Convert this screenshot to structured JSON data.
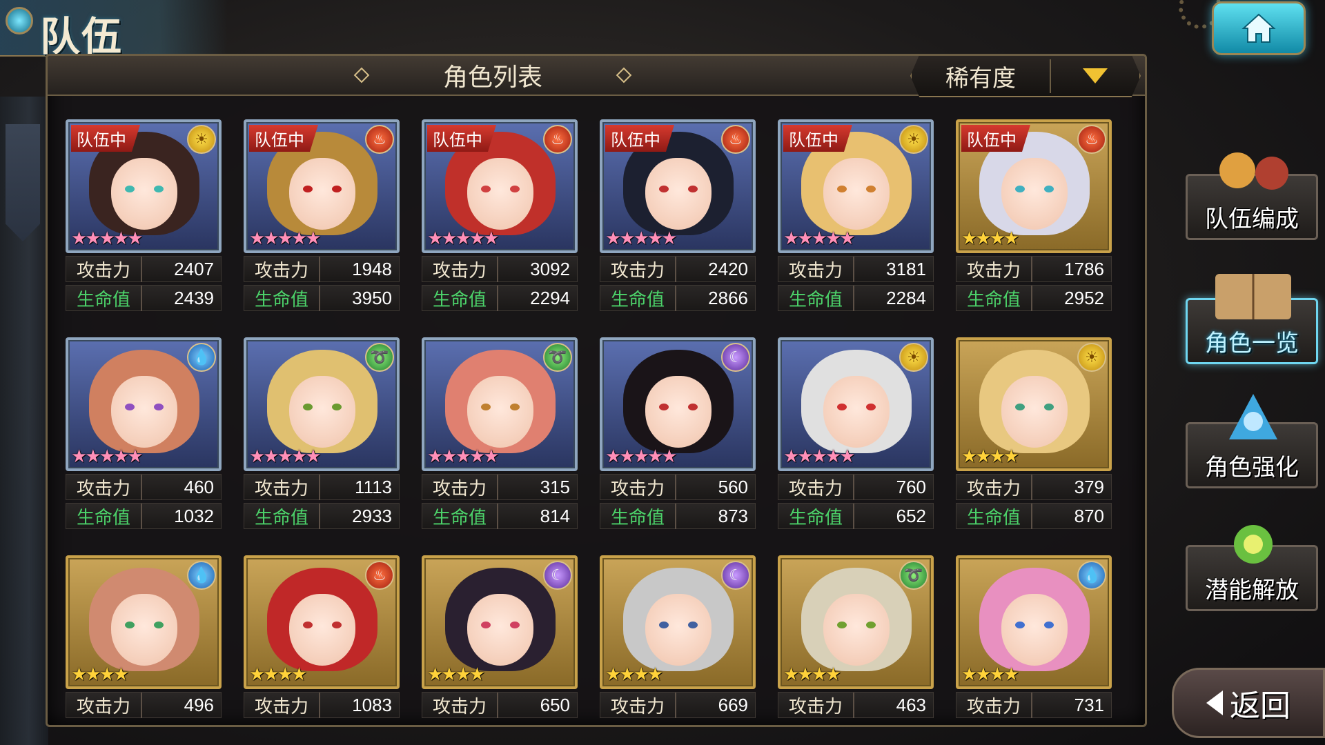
{
  "header": {
    "title": "队伍"
  },
  "panel": {
    "title": "角色列表",
    "sort_label": "稀有度"
  },
  "stat_labels": {
    "attack": "攻击力",
    "hp": "生命值"
  },
  "in_team_label": "队伍中",
  "cards": [
    {
      "in_team": true,
      "element": "light",
      "rarity": 5,
      "attack": "2407",
      "hp": "2439",
      "frame": "silver",
      "hair": "#3a2420",
      "eye": "#3fb8b0"
    },
    {
      "in_team": true,
      "element": "fire",
      "rarity": 5,
      "attack": "1948",
      "hp": "3950",
      "frame": "silver",
      "hair": "#b88a3a",
      "eye": "#c02020"
    },
    {
      "in_team": true,
      "element": "fire",
      "rarity": 5,
      "attack": "3092",
      "hp": "2294",
      "frame": "silver",
      "hair": "#c0302a",
      "eye": "#d04040"
    },
    {
      "in_team": true,
      "element": "fire",
      "rarity": 5,
      "attack": "2420",
      "hp": "2866",
      "frame": "silver",
      "hair": "#1c2030",
      "eye": "#c03030"
    },
    {
      "in_team": true,
      "element": "light",
      "rarity": 5,
      "attack": "3181",
      "hp": "2284",
      "frame": "silver",
      "hair": "#e8c070",
      "eye": "#d08030"
    },
    {
      "in_team": true,
      "element": "fire",
      "rarity": 4,
      "attack": "1786",
      "hp": "2952",
      "frame": "gold",
      "hair": "#d8d8e8",
      "eye": "#40b0c0"
    },
    {
      "in_team": false,
      "element": "water",
      "rarity": 5,
      "attack": "460",
      "hp": "1032",
      "frame": "silver",
      "hair": "#d08060",
      "eye": "#9050c0"
    },
    {
      "in_team": false,
      "element": "wind",
      "rarity": 5,
      "attack": "1113",
      "hp": "2933",
      "frame": "silver",
      "hair": "#e0c070",
      "eye": "#6a9a30"
    },
    {
      "in_team": false,
      "element": "wind",
      "rarity": 5,
      "attack": "315",
      "hp": "814",
      "frame": "silver",
      "hair": "#e08070",
      "eye": "#c08030"
    },
    {
      "in_team": false,
      "element": "dark",
      "rarity": 5,
      "attack": "560",
      "hp": "873",
      "frame": "silver",
      "hair": "#1a1418",
      "eye": "#c03030"
    },
    {
      "in_team": false,
      "element": "light",
      "rarity": 5,
      "attack": "760",
      "hp": "652",
      "frame": "silver",
      "hair": "#e0e0e0",
      "eye": "#d03030"
    },
    {
      "in_team": false,
      "element": "light",
      "rarity": 4,
      "attack": "379",
      "hp": "870",
      "frame": "gold",
      "hair": "#e8c880",
      "eye": "#40a080"
    },
    {
      "in_team": false,
      "element": "water",
      "rarity": 4,
      "attack": "496",
      "hp": "",
      "frame": "gold",
      "hair": "#d08a70",
      "eye": "#40a060"
    },
    {
      "in_team": false,
      "element": "fire",
      "rarity": 4,
      "attack": "1083",
      "hp": "",
      "frame": "gold",
      "hair": "#c02828",
      "eye": "#c03030"
    },
    {
      "in_team": false,
      "element": "dark",
      "rarity": 4,
      "attack": "650",
      "hp": "",
      "frame": "gold",
      "hair": "#2a2030",
      "eye": "#d04060"
    },
    {
      "in_team": false,
      "element": "dark",
      "rarity": 4,
      "attack": "669",
      "hp": "",
      "frame": "gold",
      "hair": "#c8c8c8",
      "eye": "#4060a0"
    },
    {
      "in_team": false,
      "element": "wind",
      "rarity": 4,
      "attack": "463",
      "hp": "",
      "frame": "gold",
      "hair": "#d8d0b8",
      "eye": "#70a030"
    },
    {
      "in_team": false,
      "element": "water",
      "rarity": 4,
      "attack": "731",
      "hp": "",
      "frame": "gold",
      "hair": "#e890c0",
      "eye": "#4070d0"
    }
  ],
  "side_menu": [
    {
      "label": "队伍编成",
      "active": false
    },
    {
      "label": "角色一览",
      "active": true
    },
    {
      "label": "角色强化",
      "active": false
    },
    {
      "label": "潜能解放",
      "active": false
    }
  ],
  "back_label": "返回",
  "element_glyphs": {
    "light": "☀",
    "fire": "♨",
    "water": "💧",
    "wind": "➰",
    "dark": "☾"
  }
}
